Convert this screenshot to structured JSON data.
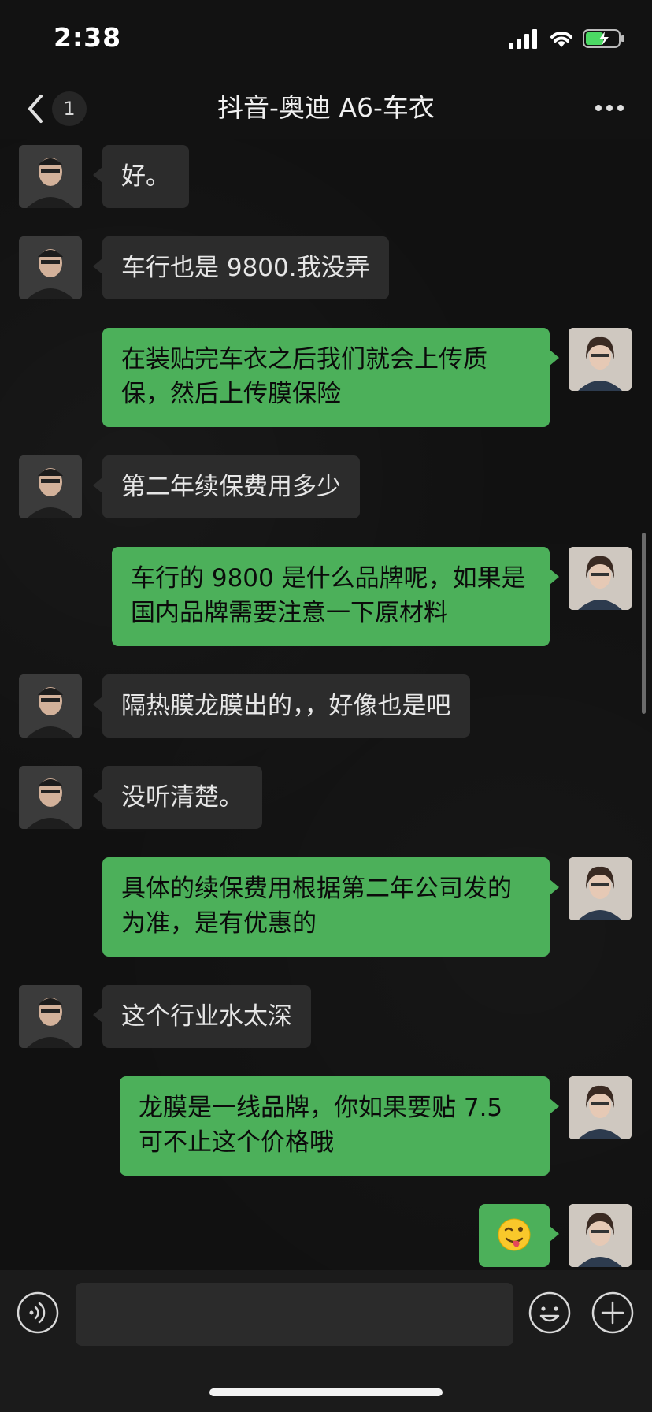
{
  "status_bar": {
    "time": "2:38"
  },
  "nav": {
    "unread_count": "1",
    "title": "抖音-奥迪 A6-车衣"
  },
  "messages": [
    {
      "side": "left",
      "text": "好。"
    },
    {
      "side": "left",
      "text": "车行也是 9800.我没弄"
    },
    {
      "side": "right",
      "text": "在装贴完车衣之后我们就会上传质保，然后上传膜保险"
    },
    {
      "side": "left",
      "text": "第二年续保费用多少"
    },
    {
      "side": "right",
      "text": "车行的 9800 是什么品牌呢，如果是国内品牌需要注意一下原材料"
    },
    {
      "side": "left",
      "text": "隔热膜龙膜出的，，好像也是吧"
    },
    {
      "side": "left",
      "text": "没听清楚。"
    },
    {
      "side": "right",
      "text": "具体的续保费用根据第二年公司发的为准，是有优惠的"
    },
    {
      "side": "left",
      "text": "这个行业水太深"
    },
    {
      "side": "right",
      "text": "龙膜是一线品牌，你如果要贴 7.5 可不止这个价格哦"
    },
    {
      "side": "right",
      "text": "😜"
    }
  ],
  "colors": {
    "background": "#111111",
    "incoming_bubble": "#2c2c2c",
    "outgoing_bubble": "#4cb05a",
    "input_bar": "#1b1b1b"
  },
  "icons": {
    "back": "chevron-left-icon",
    "more": "more-dots-icon",
    "voice": "voice-icon",
    "emoji": "emoji-icon",
    "plus": "plus-icon"
  }
}
